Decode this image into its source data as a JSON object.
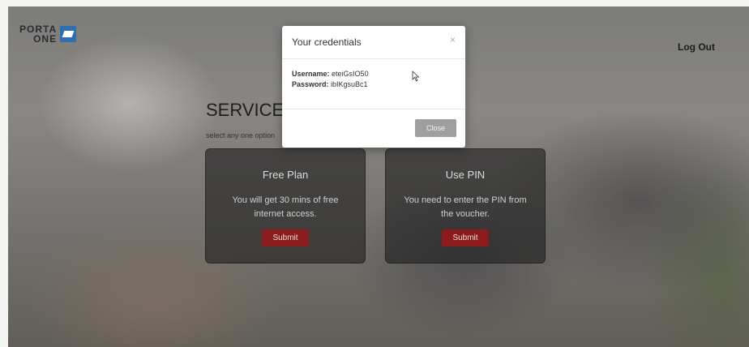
{
  "header": {
    "logo_line1": "PORTA",
    "logo_line2": "ONE",
    "logout_label": "Log Out"
  },
  "main": {
    "title": "SERVICE",
    "subtitle": "select any one option"
  },
  "cards": [
    {
      "title": "Free Plan",
      "description": "You will get 30 mins of free internet access.",
      "button": "Submit"
    },
    {
      "title": "Use PIN",
      "description": "You need to enter the PIN from the voucher.",
      "button": "Submit"
    }
  ],
  "modal": {
    "title": "Your credentials",
    "close_symbol": "×",
    "username_label": "Username:",
    "username_value": "eteiGsIO50",
    "password_label": "Password:",
    "password_value": "ibIKgsuBc1",
    "close_button": "Close"
  },
  "colors": {
    "accent": "#8c1c1c",
    "logo_blue": "#2f6fb0"
  },
  "icons": [
    "porta-one-logo-icon",
    "close-icon",
    "mouse-cursor-icon"
  ]
}
